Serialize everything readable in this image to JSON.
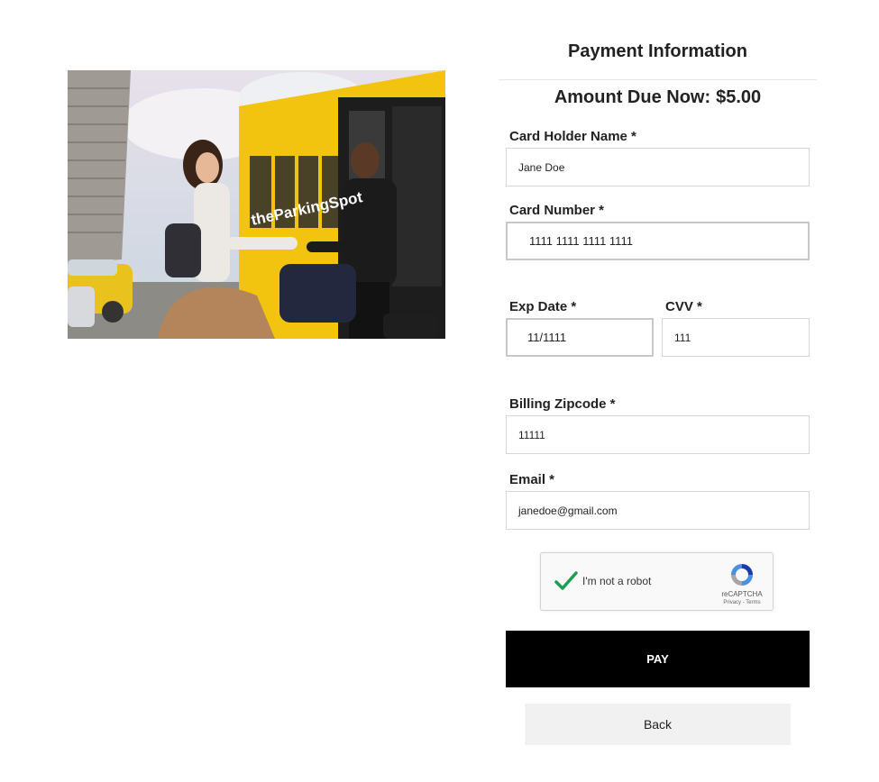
{
  "photo": {
    "alt_subject": "traveler-handing-bag-to-shuttle-driver",
    "bus_text": "theParkingSpot"
  },
  "form": {
    "title": "Payment Information",
    "amount_label": "Amount Due Now:",
    "amount_value": "$5.00",
    "card_holder_label": "Card Holder Name *",
    "card_holder_value": "Jane Doe",
    "card_number_label": "Card Number *",
    "card_number_value": "1111 1111 1111 1111",
    "exp_label": "Exp Date *",
    "exp_value": "11/1111",
    "cvv_label": "CVV *",
    "cvv_value": "111",
    "zip_label": "Billing Zipcode *",
    "zip_value": "11111",
    "email_label": "Email *",
    "email_value": "janedoe@gmail.com"
  },
  "captcha": {
    "label": "I'm not a robot",
    "brand": "reCAPTCHA",
    "terms": "Privacy - Terms",
    "checked": true,
    "check_color": "#1e9e52"
  },
  "buttons": {
    "pay_label": "PAY",
    "back_label": "Back"
  },
  "colors": {
    "pay_bg": "#000000",
    "back_bg": "#f1f1f1",
    "bus_yellow": "#f2c40f"
  }
}
